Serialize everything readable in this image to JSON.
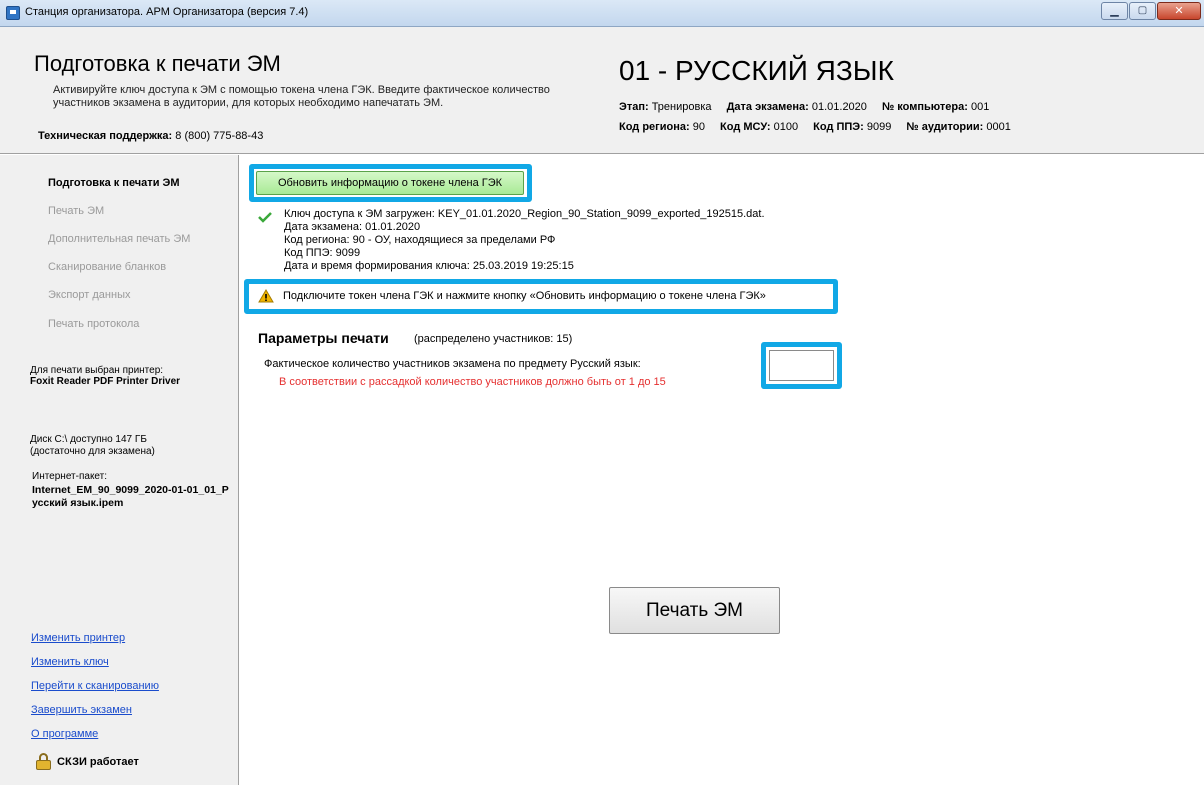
{
  "window": {
    "title": "Станция организатора. АРМ Организатора (версия 7.4)"
  },
  "header": {
    "title": "Подготовка к печати ЭМ",
    "description": "Активируйте ключ доступа к ЭМ с помощью токена члена ГЭК. Введите фактическое количество участников экзамена в аудитории, для которых необходимо напечатать ЭМ.",
    "support_label": "Техническая поддержка:",
    "support_phone": "8 (800) 775-88-43",
    "subject": "01 - РУССКИЙ ЯЗЫК",
    "stage_label": "Этап:",
    "stage_value": "Тренировка",
    "exam_date_label": "Дата экзамена:",
    "exam_date_value": "01.01.2020",
    "computer_label": "№ компьютера:",
    "computer_value": "001",
    "region_label": "Код региона:",
    "region_value": "90",
    "msu_label": "Код МСУ:",
    "msu_value": "0100",
    "ppe_label": "Код ППЭ:",
    "ppe_value": "9099",
    "room_label": "№ аудитории:",
    "room_value": "0001"
  },
  "sidebar": {
    "nav": [
      {
        "label": "Подготовка к печати ЭМ"
      },
      {
        "label": "Печать ЭМ"
      },
      {
        "label": "Дополнительная печать ЭМ"
      },
      {
        "label": "Сканирование бланков"
      },
      {
        "label": "Экспорт данных"
      },
      {
        "label": "Печать протокола"
      }
    ],
    "printer_label": "Для печати выбран принтер:",
    "printer_name": "Foxit Reader PDF Printer Driver",
    "disk_line1": "Диск С:\\ доступно 147 ГБ",
    "disk_line2": "(достаточно для экзамена)",
    "package_label": "Интернет-пакет:",
    "package_name": "Internet_EM_90_9099_2020-01-01_01_Русский язык.ipem",
    "links": [
      {
        "label": "Изменить принтер"
      },
      {
        "label": "Изменить ключ"
      },
      {
        "label": "Перейти к сканированию"
      },
      {
        "label": "Завершить экзамен"
      },
      {
        "label": "О программе"
      }
    ],
    "skzi_status": "СКЗИ работает"
  },
  "main": {
    "refresh_button": "Обновить информацию о токене члена ГЭК",
    "key_info": [
      "Ключ доступа к ЭМ загружен: KEY_01.01.2020_Region_90_Station_9099_exported_192515.dat.",
      "Дата экзамена: 01.01.2020",
      "Код региона: 90 - ОУ, находящиеся за пределами РФ",
      "Код ППЭ: 9099",
      "Дата и время формирования ключа: 25.03.2019 19:25:15"
    ],
    "warning": "Подключите токен члена ГЭК и нажмите кнопку «Обновить информацию о токене члена ГЭК»",
    "params_title": "Параметры печати",
    "params_note": "(распределено участников: 15)",
    "qty_label": "Фактическое количество участников экзамена по предмету Русский язык:",
    "qty_error": "В соответствии с рассадкой количество участников должно быть от 1 до 15",
    "qty_value": "",
    "print_button": "Печать ЭМ"
  },
  "colors": {
    "highlight": "#11a8e6",
    "error": "#e53030",
    "link": "#1a4ccc",
    "refresh_button": "#a9ea96"
  },
  "icons": [
    "app-icon",
    "minimize-icon",
    "maximize-icon",
    "close-icon",
    "check-icon",
    "warning-icon",
    "lock-icon"
  ]
}
